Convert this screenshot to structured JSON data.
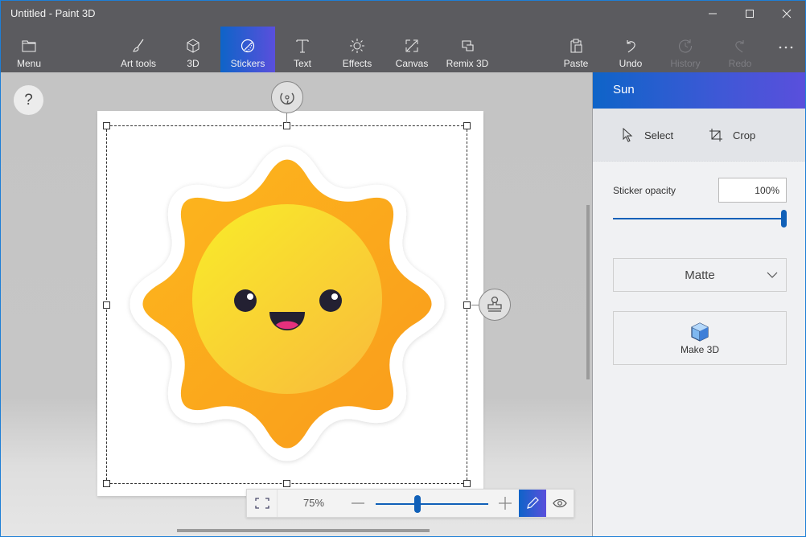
{
  "window": {
    "title": "Untitled - Paint 3D",
    "controls": [
      "minimize",
      "maximize",
      "close"
    ]
  },
  "toolbar": {
    "items": [
      {
        "label": "Menu",
        "icon": "folder-icon",
        "state": "normal"
      },
      {
        "label": "Art tools",
        "icon": "brush-icon",
        "state": "normal"
      },
      {
        "label": "3D",
        "icon": "cube-icon",
        "state": "normal"
      },
      {
        "label": "Stickers",
        "icon": "sticker-icon",
        "state": "active"
      },
      {
        "label": "Text",
        "icon": "text-icon",
        "state": "normal"
      },
      {
        "label": "Effects",
        "icon": "effects-icon",
        "state": "normal"
      },
      {
        "label": "Canvas",
        "icon": "canvas-resize-icon",
        "state": "normal"
      },
      {
        "label": "Remix 3D",
        "icon": "remix3d-icon",
        "state": "normal"
      },
      {
        "label": "Paste",
        "icon": "paste-icon",
        "state": "normal"
      },
      {
        "label": "Undo",
        "icon": "undo-icon",
        "state": "normal"
      },
      {
        "label": "History",
        "icon": "history-icon",
        "state": "disabled"
      },
      {
        "label": "Redo",
        "icon": "redo-icon",
        "state": "disabled"
      }
    ],
    "more_label": "..."
  },
  "workspace": {
    "help_label": "?",
    "sticker_name": "Sun",
    "zoom": {
      "percent_label": "75%",
      "value_fraction": 0.37
    }
  },
  "panel": {
    "title": "Sun",
    "tools": [
      {
        "label": "Select",
        "icon": "cursor-icon"
      },
      {
        "label": "Crop",
        "icon": "crop-icon"
      }
    ],
    "opacity": {
      "label": "Sticker opacity",
      "value": "100%",
      "fraction": 1.0
    },
    "finish": {
      "selected": "Matte"
    },
    "make3d_label": "Make 3D"
  },
  "colors": {
    "accent_start": "#0e64c8",
    "accent_end": "#5a4fdc",
    "chrome": "#5b5b5f",
    "sun_rays": "#fba81c",
    "sun_face": "#f7de2e",
    "mouth_tongue": "#e5307d"
  }
}
